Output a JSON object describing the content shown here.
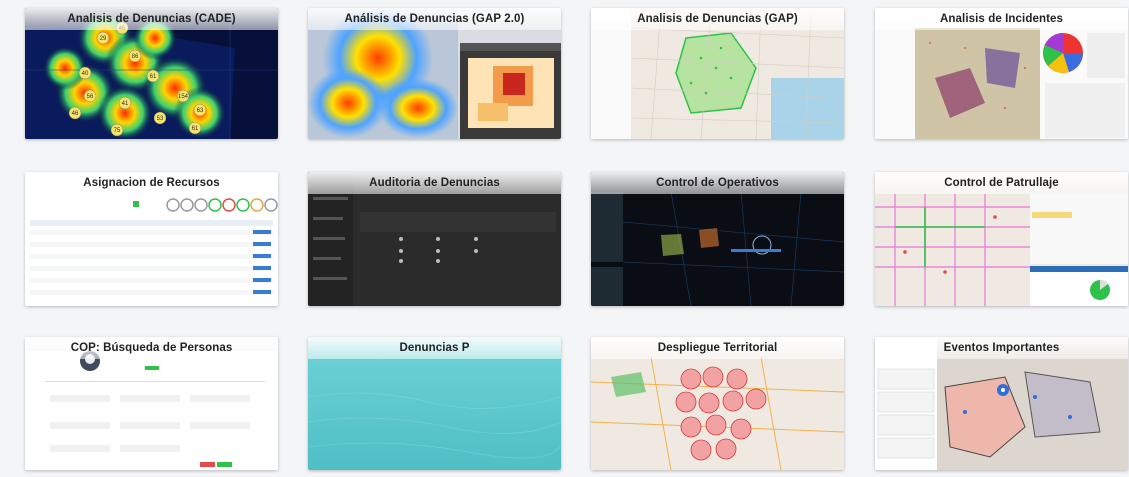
{
  "cards": [
    {
      "id": "cade",
      "title": "Analisis de Denuncias (CADE)",
      "thumb": "heatmap-dark",
      "labels": [
        "29",
        "45",
        "86",
        "40",
        "61",
        "154",
        "63",
        "56",
        "41",
        "53",
        "75",
        "61",
        "46"
      ]
    },
    {
      "id": "gap2",
      "title": "Análisis de Denuncias (GAP 2.0)",
      "thumb": "heatmap-light"
    },
    {
      "id": "gap",
      "title": "Analisis de Denuncias (GAP)",
      "thumb": "street-map-green"
    },
    {
      "id": "incidentes",
      "title": "Analisis de Incidentes",
      "thumb": "map-pie"
    },
    {
      "id": "recursos",
      "title": "Asignacion de Recursos",
      "thumb": "table-circles"
    },
    {
      "id": "auditoria",
      "title": "Auditoria de Denuncias",
      "thumb": "dark-form"
    },
    {
      "id": "operativos",
      "title": "Control de Operativos",
      "thumb": "dark-map"
    },
    {
      "id": "patrullaje",
      "title": "Control de Patrullaje",
      "thumb": "patrol-map"
    },
    {
      "id": "cop",
      "title": "COP: Búsqueda de Personas",
      "thumb": "search-form"
    },
    {
      "id": "denunciasp",
      "title": "Denuncias P",
      "thumb": "teal"
    },
    {
      "id": "despliegue",
      "title": "Despliegue Territorial",
      "thumb": "circles-map"
    },
    {
      "id": "eventos",
      "title": "Eventos Importantes",
      "thumb": "events-map"
    }
  ],
  "colors": {
    "heat_dark_bg": "#07103a",
    "teal": "#5ec9cf",
    "map_bg": "#efe9e2",
    "dark_bg": "#2b2b2b",
    "green": "#2ec24a",
    "red": "#e04b4b"
  },
  "icons": {
    "corner": "settings-icon"
  }
}
